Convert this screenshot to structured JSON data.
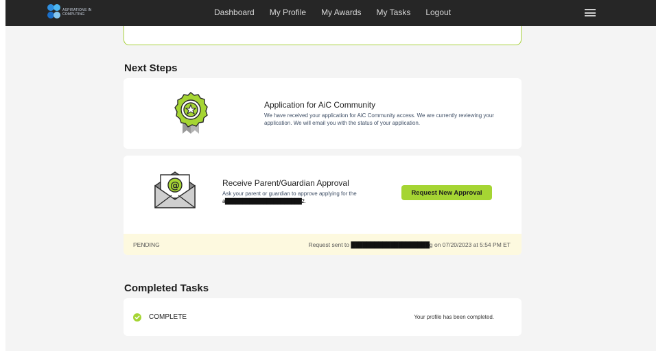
{
  "navbar": {
    "logo_text_line1": "ASPIRATIONS IN",
    "logo_text_line2": "COMPUTING",
    "links": [
      "Dashboard",
      "My Profile",
      "My Awards",
      "My Tasks",
      "Logout"
    ]
  },
  "next_steps": {
    "heading": "Next Steps",
    "community": {
      "title": "Application for AiC Community",
      "description": "We have received your application for AiC Community access. We are currently reviewing your application. We will email you with the status of your application."
    },
    "parent_approval": {
      "title": "Receive Parent/Guardian Approval",
      "description_line1": "Ask your parent or guardian to approve applying for the",
      "description_line2": "a██████████████████████2.",
      "button_label": "Request New Approval",
      "status": "PENDING",
      "request_prefix": "Request sent to",
      "request_email": "████████████████████",
      "request_suffix": "g on 07/20/2023 at 5:54 PM ET"
    }
  },
  "completed_tasks": {
    "heading": "Completed Tasks",
    "items": [
      {
        "status": "COMPLETE",
        "description": "Your profile has been completed."
      }
    ]
  },
  "colors": {
    "accent_green": "#a5d533",
    "navbar_bg": "#262626",
    "pending_bg": "#fdf9df"
  }
}
